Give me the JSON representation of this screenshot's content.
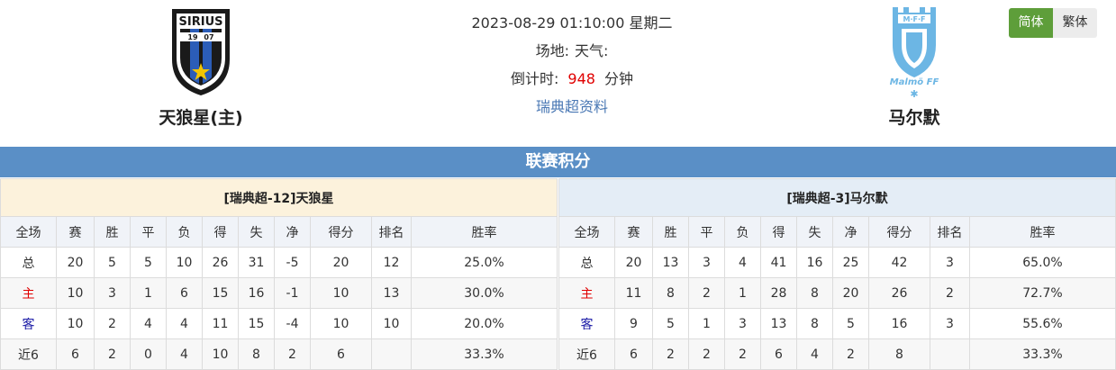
{
  "home_team": {
    "name": "天狼星(主)",
    "logo_text": "SIRIUS",
    "logo_year_left": "19",
    "logo_year_right": "07"
  },
  "away_team": {
    "name": "马尔默",
    "logo_text_top": "M·F·F",
    "logo_text_bottom": "Malmö FF"
  },
  "match": {
    "datetime": "2023-08-29 01:10:00 星期二",
    "venue_label": "场地:",
    "weather_label": "天气:",
    "countdown_label": "倒计时:",
    "countdown_value": "948",
    "countdown_unit": "分钟",
    "league_link": "瑞典超资料"
  },
  "lang": {
    "simplified": "简体",
    "traditional": "繁体"
  },
  "section_title": "联赛积分",
  "columns": [
    "全场",
    "赛",
    "胜",
    "平",
    "负",
    "得",
    "失",
    "净",
    "得分",
    "排名",
    "胜率"
  ],
  "home_table": {
    "title": "[瑞典超-12]天狼星",
    "rows": [
      [
        "总",
        "20",
        "5",
        "5",
        "10",
        "26",
        "31",
        "-5",
        "20",
        "12",
        "25.0%"
      ],
      [
        "主",
        "10",
        "3",
        "1",
        "6",
        "15",
        "16",
        "-1",
        "10",
        "13",
        "30.0%"
      ],
      [
        "客",
        "10",
        "2",
        "4",
        "4",
        "11",
        "15",
        "-4",
        "10",
        "10",
        "20.0%"
      ],
      [
        "近6",
        "6",
        "2",
        "0",
        "4",
        "10",
        "8",
        "2",
        "6",
        "",
        "33.3%"
      ]
    ]
  },
  "away_table": {
    "title": "[瑞典超-3]马尔默",
    "rows": [
      [
        "总",
        "20",
        "13",
        "3",
        "4",
        "41",
        "16",
        "25",
        "42",
        "3",
        "65.0%"
      ],
      [
        "主",
        "11",
        "8",
        "2",
        "1",
        "28",
        "8",
        "20",
        "26",
        "2",
        "72.7%"
      ],
      [
        "客",
        "9",
        "5",
        "1",
        "3",
        "13",
        "8",
        "5",
        "16",
        "3",
        "55.6%"
      ],
      [
        "近6",
        "6",
        "2",
        "2",
        "2",
        "6",
        "4",
        "2",
        "8",
        "",
        "33.3%"
      ]
    ]
  },
  "colors": {
    "section_bar": "#5a8fc6",
    "countdown": "#e00000",
    "link": "#4a78b4",
    "lang_active": "#5e9e3a"
  }
}
